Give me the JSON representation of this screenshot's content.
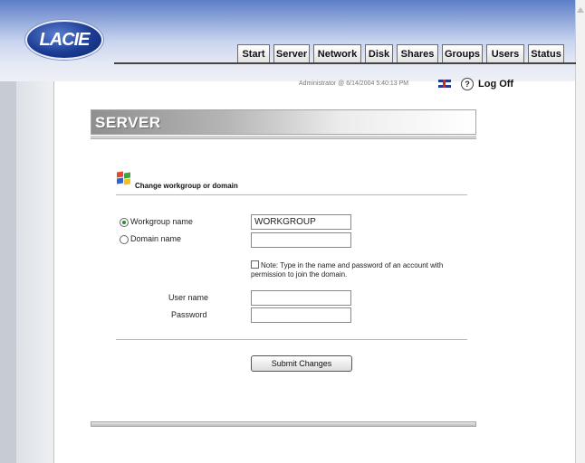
{
  "brand": {
    "logo_text": "LACIE"
  },
  "tabs": [
    {
      "label": "Start",
      "w": 0
    },
    {
      "label": "Server"
    },
    {
      "label": "Network"
    },
    {
      "label": "Disk"
    },
    {
      "label": "Shares"
    },
    {
      "label": "Groups"
    },
    {
      "label": "Users"
    },
    {
      "label": "Status"
    }
  ],
  "status": {
    "user_time": "Administrator  @  6/14/2004 5:40:13 PM",
    "language_icon": "uk-flag-icon",
    "help_icon": "help-icon",
    "help_glyph": "?",
    "logoff_label": "Log Off"
  },
  "page": {
    "title": "SERVER"
  },
  "section": {
    "icon": "windows-logo-icon",
    "title": "Change workgroup or domain"
  },
  "form": {
    "workgroup_label": "Workgroup name",
    "workgroup_value": "WORKGROUP",
    "workgroup_selected": true,
    "domain_label": "Domain name",
    "domain_value": "",
    "note_icon": "note-icon",
    "note_text": "Note: Type in the name and password of an account with permission to join the domain.",
    "username_label": "User name",
    "username_value": "",
    "password_label": "Password",
    "password_value": "",
    "submit_label": "Submit Changes"
  }
}
